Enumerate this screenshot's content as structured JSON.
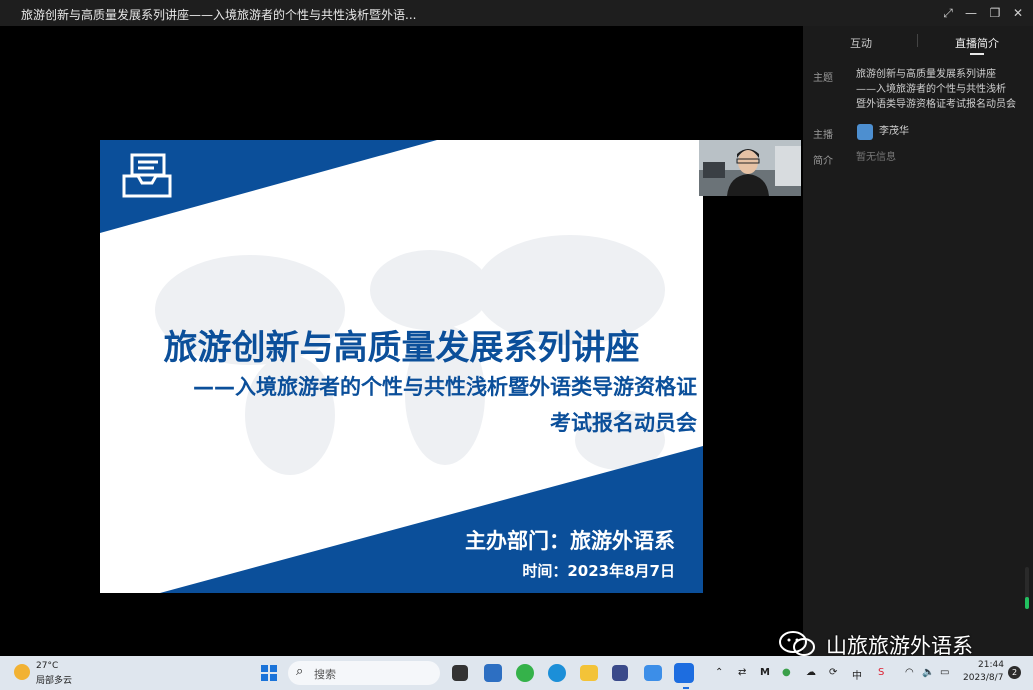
{
  "window": {
    "title": "旅游创新与高质量发展系列讲座——入境旅游者的个性与共性浅析暨外语...",
    "controls": {
      "fullscreen": "⤢",
      "minimize": "—",
      "restore": "❐",
      "close": "✕"
    }
  },
  "slide": {
    "title": "旅游创新与高质量发展系列讲座",
    "subtitle_line1": "——入境旅游者的个性与共性浅析暨外语类导游资格证",
    "subtitle_line2": "考试报名动员会",
    "organizer": "主办部门：旅游外语系",
    "time": "时间：2023年8月7日",
    "colors": {
      "brand_blue": "#0b4f9a",
      "white": "#ffffff"
    }
  },
  "side_panel": {
    "tabs": [
      {
        "label": "互动",
        "active": false
      },
      {
        "label": "直播简介",
        "active": true
      }
    ],
    "info": {
      "topic_label": "主题",
      "topic_lines": [
        "旅游创新与高质量发展系列讲座",
        "——入境旅游者的个性与共性浅析",
        "暨外语类导游资格证考试报名动员会"
      ],
      "host_label": "主播",
      "host_name": "李茂华",
      "intro_label": "简介",
      "intro_value": "暂无信息"
    }
  },
  "watermark": {
    "text": "山旅旅游外语系",
    "icon": "wechat-icon"
  },
  "taskbar": {
    "weather_temp": "27°C",
    "weather_desc": "局部多云",
    "search_placeholder": "搜索",
    "apps": [
      "start-icon",
      "search-icon",
      "task-view-icon",
      "store-icon",
      "edge-icon",
      "edge-browser-icon",
      "file-explorer-icon",
      "app-icon",
      "cloud-icon",
      "live-app-icon"
    ],
    "tray": {
      "ime": "中",
      "clock_time": "21:44",
      "clock_date": "2023/8/7",
      "notifications": "2"
    }
  }
}
